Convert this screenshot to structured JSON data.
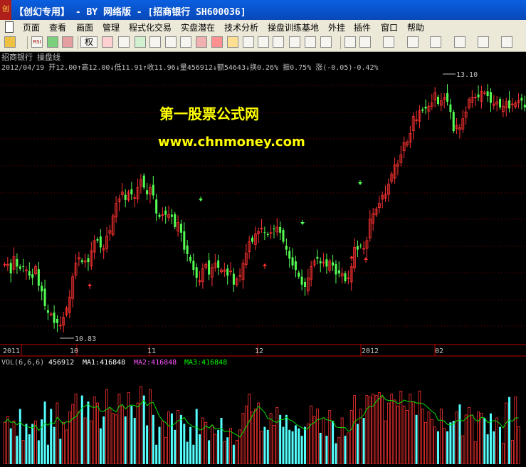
{
  "window": {
    "title": "【创幻专用】 - BY 网络版 - [招商银行 SH600036]",
    "logo_text": "创"
  },
  "menu": [
    "页面",
    "查看",
    "画面",
    "管理",
    "程式化交易",
    "实盘潜在",
    "技术分析",
    "操盘训练基地",
    "外挂",
    "插件",
    "窗口",
    "帮助"
  ],
  "toolbar": {
    "rights_label": "权"
  },
  "stock": {
    "name": "招商银行",
    "indicator": "操盘线"
  },
  "quote_line": "2012/04/19 开12.00↑高12.00↓低11.91↑收11.96↓量456912↓额54643↓换0.26% 振0.75% 涨(-0.05)-0.42%",
  "watermark": {
    "line1": "第一股票公式网",
    "line2": "www.chnmoney.com"
  },
  "price_annotations": {
    "high": "13.10",
    "low": "10.83"
  },
  "time_axis": [
    "2011",
    "10",
    "11",
    "12",
    "2012",
    "02"
  ],
  "vol_header": {
    "label": "VOL(6,6,6)",
    "volume": "456912",
    "ma1": "MA1:416848",
    "ma2": "MA2:416848",
    "ma3": "MA3:416848"
  },
  "colors": {
    "up": "#ff3232",
    "down": "#54ff54",
    "vol_down": "#54ffff",
    "ma1": "#ffffff",
    "ma2": "#ff54ff",
    "ma3": "#00ff00",
    "watermark": "#ffff00",
    "axis": "#c00000"
  },
  "chart_data": {
    "type": "candlestick",
    "price_range": [
      10.83,
      13.1
    ],
    "closes": [
      11.44,
      11.44,
      11.36,
      11.51,
      11.42,
      11.4,
      11.42,
      11.39,
      11.34,
      11.32,
      11.42,
      11.25,
      11.2,
      11.07,
      11.01,
      11.0,
      10.92,
      10.92,
      10.9,
      10.97,
      11.05,
      11.15,
      11.33,
      11.45,
      11.5,
      11.46,
      11.47,
      11.46,
      11.56,
      11.65,
      11.65,
      11.59,
      11.58,
      11.69,
      11.74,
      11.87,
      11.98,
      12.02,
      12.08,
      12.01,
      12.08,
      12.06,
      12.03,
      12.12,
      12.19,
      12.12,
      12.06,
      12.12,
      12.05,
      11.89,
      11.86,
      11.88,
      11.88,
      11.88,
      11.86,
      11.77,
      11.81,
      11.72,
      11.57,
      11.53,
      11.47,
      11.39,
      11.32,
      11.3,
      11.4,
      11.44,
      11.35,
      11.41,
      11.45,
      11.41,
      11.39,
      11.39,
      11.34,
      11.38,
      11.26,
      11.31,
      11.34,
      11.45,
      11.54,
      11.64,
      11.64,
      11.71,
      11.73,
      11.76,
      11.72,
      11.7,
      11.72,
      11.75,
      11.77,
      11.72,
      11.64,
      11.57,
      11.49,
      11.43,
      11.39,
      11.33,
      11.26,
      11.24,
      11.32,
      11.42,
      11.47,
      11.49,
      11.45,
      11.46,
      11.42,
      11.47,
      11.43,
      11.35,
      11.36,
      11.36,
      11.29,
      11.32,
      11.42,
      11.59,
      11.57,
      11.6,
      11.58,
      11.65,
      11.84,
      11.89,
      11.93,
      11.98,
      12.05,
      12.06,
      12.15,
      12.24,
      12.32,
      12.33,
      12.41,
      12.52,
      12.52,
      12.6,
      12.75,
      12.72,
      12.8,
      12.8,
      12.82,
      12.84,
      12.87,
      12.96,
      12.86,
      12.89,
      12.92,
      12.88,
      12.79,
      12.62,
      12.67,
      12.65,
      12.73,
      12.79,
      12.9,
      12.92,
      12.92,
      12.92,
      12.97,
      12.96,
      12.93,
      12.87,
      12.86,
      12.88,
      12.83,
      12.84,
      12.88,
      12.82,
      12.86,
      12.87,
      12.89,
      12.89,
      12.83
    ],
    "volumes": [
      2.8,
      3.2,
      2.4,
      2.9,
      1.9,
      3.7,
      1.6,
      2.7,
      2.0,
      2.7,
      2.9,
      1.6,
      3.0,
      4.2,
      1.3,
      3.7,
      2.5,
      4.1,
      1.7,
      2.8,
      2.3,
      3.5,
      4.0,
      4.7,
      3.5,
      4.6,
      3.1,
      4.2,
      2.9,
      4.5,
      4.1,
      2.4,
      3.2,
      5.0,
      3.7,
      3.4,
      3.3,
      4.7,
      3.9,
      3.2,
      4.8,
      3.9,
      3.1,
      4.1,
      5.2,
      4.6,
      2.6,
      5.0,
      3.3,
      1.3,
      2.5,
      2.9,
      1.8,
      3.5,
      3.4,
      2.3,
      3.6,
      3.3,
      2.7,
      1.5,
      2.5,
      1.3,
      3.7,
      2.0,
      3.1,
      2.8,
      1.6,
      2.6,
      2.0,
      2.3,
      3.1,
      1.5,
      1.8,
      2.4,
      1.3,
      1.6,
      2.3,
      3.4,
      3.9,
      4.7,
      3.5,
      3.7,
      4.1,
      2.2,
      2.5,
      2.3,
      3.4,
      2.6,
      3.8,
      3.3,
      2.5,
      3.3,
      2.3,
      2.2,
      2.6,
      2.4,
      1.9,
      2.5,
      2.7,
      3.9,
      3.2,
      3.7,
      2.1,
      3.1,
      1.9,
      3.6,
      2.9,
      1.4,
      1.8,
      3.1,
      1.9,
      2.1,
      3.6,
      4.6,
      2.7,
      3.7,
      3.1,
      4.6,
      4.5,
      4.7,
      4.6,
      4.8,
      4.5,
      2.9,
      4.1,
      4.7,
      4.3,
      3.9,
      4.9,
      3.9,
      3.6,
      4.7,
      4.2,
      3.3,
      4.9,
      3.7,
      2.8,
      3.5,
      3.0,
      2.5,
      2.2,
      3.7,
      2.4,
      2.2,
      2.8,
      2.9,
      3.5,
      4.0,
      1.9,
      3.3,
      3.8,
      3.3,
      1.5,
      3.5,
      3.4,
      3.1,
      2.0,
      3.4,
      2.2,
      3.1,
      2.5,
      1.4,
      4.1,
      4.5,
      1.6,
      4.5,
      2.5
    ]
  }
}
